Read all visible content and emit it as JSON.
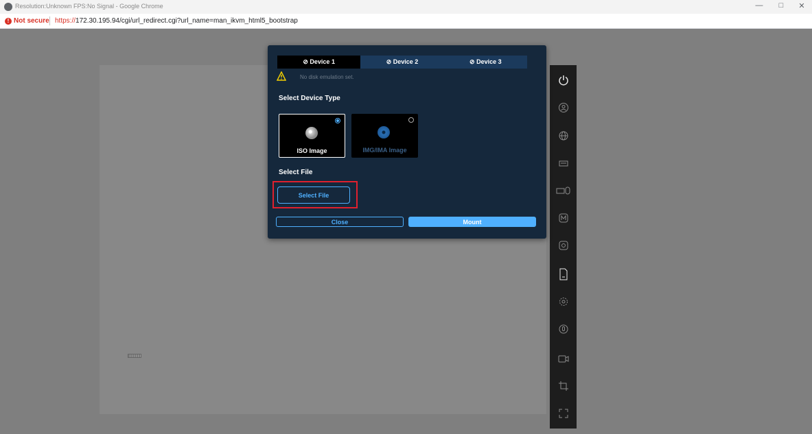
{
  "browser": {
    "window_title": "Resolution:Unknown FPS:No Signal - Google Chrome",
    "security_label": "Not secure",
    "url_scheme": "https://",
    "url_rest": "172.30.195.94/cgi/url_redirect.cgi?url_name=man_ikvm_html5_bootstrap"
  },
  "dialog": {
    "tabs": [
      {
        "label": "⊘ Device 1",
        "active": true
      },
      {
        "label": "⊘ Device 2",
        "active": false
      },
      {
        "label": "⊘ Device 3",
        "active": false
      }
    ],
    "warning_text": "No disk emulation set.",
    "device_type_title": "Select Device Type",
    "device_types": [
      {
        "label": "ISO Image",
        "selected": true
      },
      {
        "label": "IMG/IMA Image",
        "selected": false
      }
    ],
    "select_file_title": "Select File",
    "select_file_button": "Select File",
    "close_button": "Close",
    "mount_button": "Mount"
  },
  "toolbar": {
    "icons": [
      "power-icon",
      "user-icon",
      "globe-icon",
      "keyboard-icon",
      "keyboard-mouse-icon",
      "macro-icon",
      "virtual-media-icon",
      "file-icon",
      "settings-icon",
      "mouse-icon",
      "video-record-icon",
      "crop-icon",
      "fullscreen-icon"
    ]
  },
  "colors": {
    "dialog_bg": "#15283c",
    "accent": "#4fb0ff",
    "highlight": "#e0202e"
  }
}
